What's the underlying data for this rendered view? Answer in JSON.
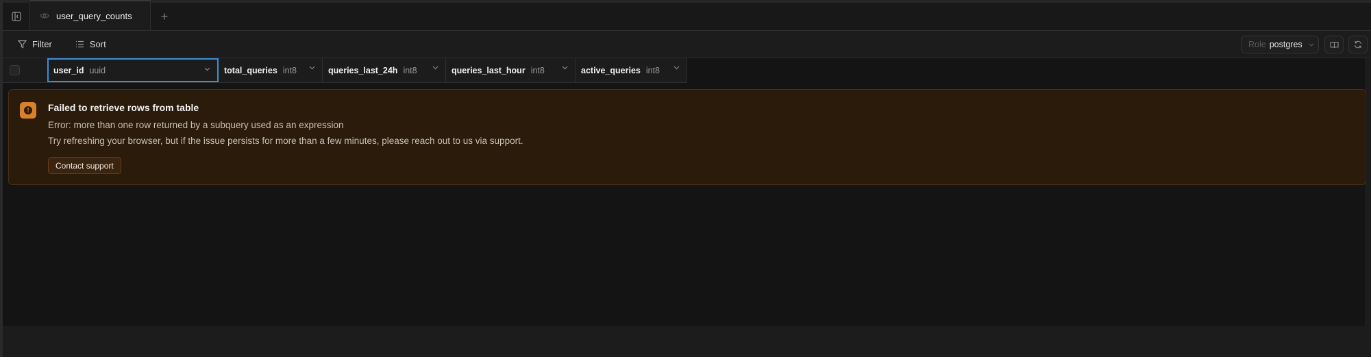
{
  "tabbar": {
    "active_tab_label": "user_query_counts",
    "add_tab_symbol": "+"
  },
  "toolbar": {
    "filter_label": "Filter",
    "sort_label": "Sort",
    "role_label": "Role",
    "role_value": "postgres"
  },
  "grid": {
    "columns": [
      {
        "name": "user_id",
        "type": "uuid"
      },
      {
        "name": "total_queries",
        "type": "int8"
      },
      {
        "name": "queries_last_24h",
        "type": "int8"
      },
      {
        "name": "queries_last_hour",
        "type": "int8"
      },
      {
        "name": "active_queries",
        "type": "int8"
      }
    ]
  },
  "error": {
    "title": "Failed to retrieve rows from table",
    "message": "Error: more than one row returned by a subquery used as an expression",
    "hint": "Try refreshing your browser, but if the issue persists for more than a few minutes, please reach out to us via support.",
    "button_label": "Contact support",
    "icon_symbol": "!"
  },
  "colors": {
    "accent_border": "#3b8ed8",
    "warning": "#d9802a",
    "error_bg": "#2a1b0a"
  },
  "icons": {
    "sidebar": "sidebar-toggle-icon",
    "view": "eye-icon",
    "filter": "filter-icon",
    "sort": "sort-list-icon",
    "docs": "book-icon",
    "refresh": "refresh-icon",
    "warning": "warning-icon",
    "chevron": "chevron-down-icon"
  }
}
